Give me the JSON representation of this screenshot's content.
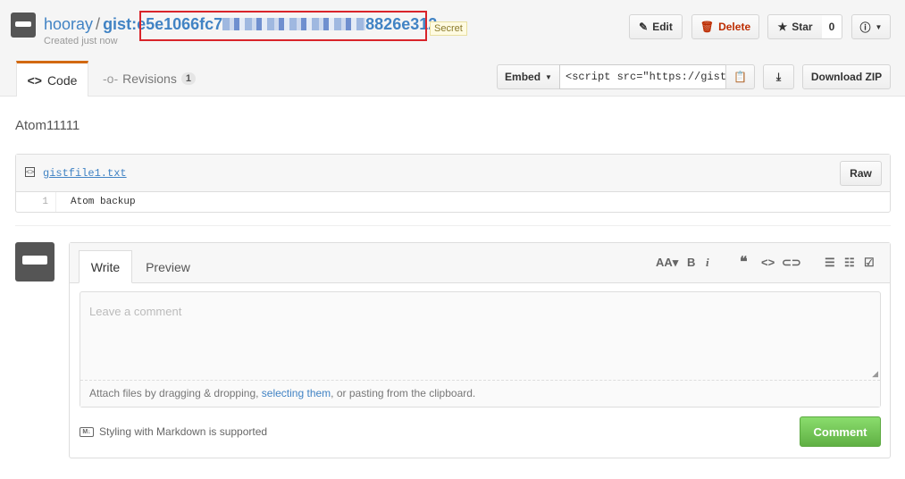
{
  "header": {
    "user": "hooray",
    "separator": "/",
    "gist_prefix": "gist:",
    "gist_id_start": "e5e1066fc7",
    "gist_id_end": "8826e312",
    "secret_badge": "Secret",
    "created": "Created just now"
  },
  "actions": {
    "edit": "Edit",
    "delete": "Delete",
    "star": "Star",
    "star_count": "0"
  },
  "tabs": {
    "code": "Code",
    "revisions": "Revisions",
    "revisions_count": "1"
  },
  "embed": {
    "label": "Embed",
    "value": "<script src=\"https://gist",
    "download": "Download ZIP"
  },
  "description": "Atom11111",
  "file": {
    "name": "gistfile1.txt",
    "raw": "Raw",
    "lines": [
      {
        "num": "1",
        "text": "Atom backup"
      }
    ]
  },
  "comment": {
    "write_tab": "Write",
    "preview_tab": "Preview",
    "placeholder": "Leave a comment",
    "attach_before": "Attach files by dragging & dropping, ",
    "attach_link": "selecting them",
    "attach_after": ", or pasting from the clipboard.",
    "markdown_note": "Styling with Markdown is supported",
    "submit": "Comment"
  },
  "colors": {
    "link": "#4183c4",
    "accent_tab": "#d26911",
    "highlight": "#d9242a",
    "comment_button": "#60b044"
  }
}
